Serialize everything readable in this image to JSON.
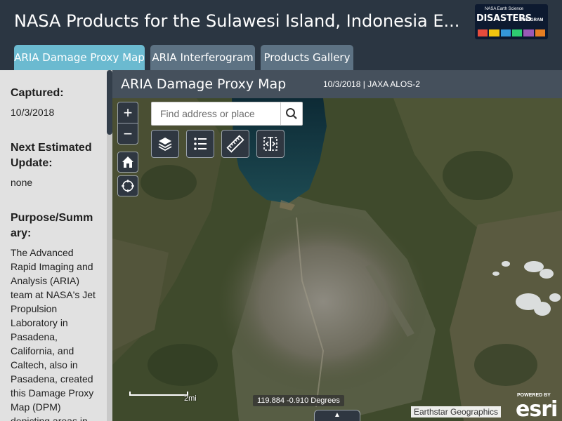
{
  "app": {
    "title": "NASA Products for the Sulawesi Island, Indonesia E...",
    "logo": {
      "small_text": "NASA Earth Science",
      "big_text": "DISASTERS",
      "side_text": "PROGRAM"
    }
  },
  "tabs": [
    {
      "label": "ARIA Damage Proxy Map",
      "active": true
    },
    {
      "label": "ARIA Interferogram",
      "active": false
    },
    {
      "label": "Products Gallery",
      "active": false
    }
  ],
  "sidebar": {
    "captured_label": "Captured:",
    "captured_value": "10/3/2018",
    "next_update_label": "Next Estimated Update:",
    "next_update_value": "none",
    "purpose_label": "Purpose/Summary:",
    "purpose_text": "The Advanced Rapid Imaging and Analysis (ARIA) team at NASA's Jet Propulsion Laboratory in Pasadena, California, and Caltech, also in Pasadena, created this Damage Proxy Map (DPM) depicting areas in"
  },
  "map": {
    "title": "ARIA Damage Proxy Map",
    "meta": "10/3/2018 | JAXA ALOS-2",
    "search_placeholder": "Find address or place",
    "scale_label": "2mi",
    "coords": "119.884 -0.910 Degrees",
    "attribution": "Earthstar Geographics",
    "esri_powered": "POWERED BY",
    "esri_word": "esri",
    "zoom_in_symbol": "+",
    "zoom_out_symbol": "−",
    "collapse_symbol": "▲"
  },
  "icons": {
    "zoom_in": "plus-icon",
    "zoom_out": "minus-icon",
    "home": "home-icon",
    "locate": "locate-icon",
    "search": "search-icon",
    "layers": "layers-icon",
    "legend": "legend-list-icon",
    "measure": "ruler-icon",
    "swipe": "swipe-compare-icon"
  },
  "colors": {
    "header_bg": "#2b3642",
    "active_tab": "#6bbad0",
    "inactive_tab": "#5d7283",
    "sidebar_bg": "#e1e1e1",
    "map_header_bg": "#45505c"
  }
}
